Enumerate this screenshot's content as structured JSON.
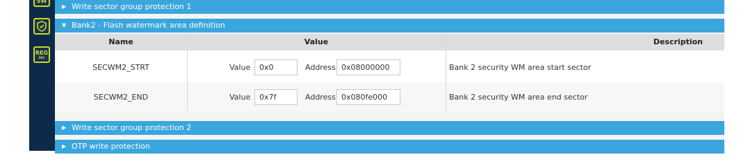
{
  "sidebar": {
    "icons": [
      {
        "name": "sw-icon",
        "text": "SW"
      },
      {
        "name": "shield-icon"
      },
      {
        "name": "reg-icon",
        "text": "REG",
        "sub": "DEF"
      }
    ],
    "accent": "#c9dc24"
  },
  "sections": [
    {
      "title": "Write sector group protection 1",
      "state": "collapsed"
    },
    {
      "title": "Bank2 - Flash watermark area definition",
      "state": "expanded"
    },
    {
      "title": "Write sector group protection 2",
      "state": "collapsed"
    },
    {
      "title": "OTP write protection",
      "state": "collapsed"
    }
  ],
  "table": {
    "headers": {
      "name": "Name",
      "value": "Value",
      "description": "Description"
    },
    "rows": [
      {
        "name": "SECWM2_STRT",
        "value_label": "Value",
        "value": "0x0",
        "address_label": "Address",
        "address": "0x08000000",
        "description": "Bank 2 security WM area start sector"
      },
      {
        "name": "SECWM2_END",
        "value_label": "Value",
        "value": "0x7f",
        "address_label": "Address",
        "address": "0x080fe000",
        "description": "Bank 2 security WM area end sector"
      }
    ]
  },
  "colors": {
    "section_bar": "#3aa6dd",
    "sidebar": "#0e2a4a",
    "header_bg": "#dedede"
  }
}
